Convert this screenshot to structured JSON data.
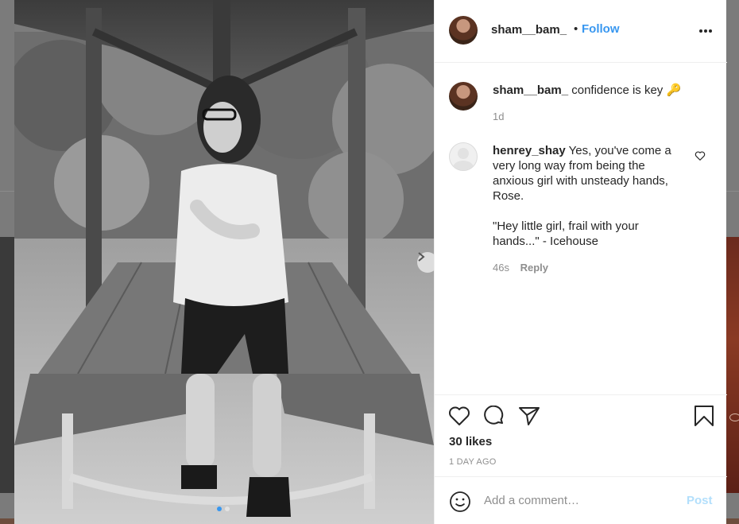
{
  "post": {
    "author": "sham__bam_",
    "follow_label": "Follow",
    "separator": "•",
    "caption": "confidence is key 🔑",
    "caption_time": "1d",
    "likes": "30 likes",
    "date": "1 DAY AGO"
  },
  "comments": [
    {
      "user": "henrey_shay",
      "text_line1": "Yes, you've come a",
      "text_line2": "very long way from being the",
      "text_line3": "anxious girl with unsteady hands,",
      "text_line4": "Rose.",
      "text_line5": "\"Hey little girl, frail with your",
      "text_line6": "hands...\" - Icehouse",
      "time": "46s",
      "reply_label": "Reply"
    }
  ],
  "composer": {
    "placeholder": "Add a comment…",
    "post_label": "Post"
  },
  "carousel": {
    "slide_count": 2,
    "active_slide": 1
  },
  "icons": {
    "more": "more-horizontal-icon",
    "like": "heart-icon",
    "comment": "speech-bubble-icon",
    "share": "paper-plane-icon",
    "save": "bookmark-icon",
    "emoji": "smiley-icon",
    "next": "chevron-right-icon"
  },
  "colors": {
    "accent": "#3897f0",
    "post_disabled": "#b2dffc",
    "muted": "#8e8e8e"
  }
}
